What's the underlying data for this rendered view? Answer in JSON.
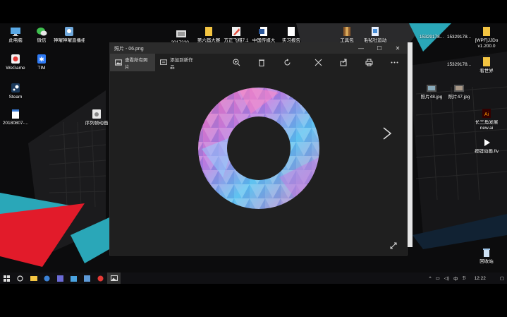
{
  "desktop": {
    "left_icons": [
      {
        "label": "此电脑",
        "icon": "computer-icon"
      },
      {
        "label": "微信",
        "icon": "wechat-icon"
      },
      {
        "label": "神曜神曜直播组",
        "icon": "app-icon"
      },
      {
        "label": "WeGame",
        "icon": "wegame-icon"
      },
      {
        "label": "TIM",
        "icon": "tim-icon"
      },
      {
        "label": "Steam",
        "icon": "steam-icon"
      },
      {
        "label": "20180807-...",
        "icon": "document-icon"
      },
      {
        "label": "序列帧动画",
        "icon": "folder-icon"
      }
    ],
    "top_icons": [
      {
        "label": "2017220..",
        "icon": "image-file-icon"
      },
      {
        "label": "第六届大赛",
        "icon": "folder-icon"
      },
      {
        "label": "方正飞翔7.1",
        "icon": "app-icon"
      },
      {
        "label": "中国传媒大",
        "icon": "word-file-icon"
      },
      {
        "label": "实习报告",
        "icon": "document-icon"
      },
      {
        "label": "工具包",
        "icon": "archive-icon"
      },
      {
        "label": "毛毡社运动",
        "icon": "folder-icon"
      }
    ],
    "right_icons": [
      {
        "label": "15329178...",
        "icon": "image-file-icon"
      },
      {
        "label": "15329178...",
        "icon": "image-file-icon"
      },
      {
        "label": "[WPF]JJDo v1.200.0",
        "icon": "folder-icon"
      },
      {
        "label": "15329178...",
        "icon": "image-file-icon"
      },
      {
        "label": "看世界",
        "icon": "folder-icon"
      },
      {
        "label": "照片48.jpg",
        "icon": "image-file-icon"
      },
      {
        "label": "照片47.jpg",
        "icon": "image-file-icon"
      },
      {
        "label": "长三角发展 new.ai",
        "icon": "illustrator-file-icon"
      },
      {
        "label": "按钮动画.flv",
        "icon": "video-file-icon"
      },
      {
        "label": "回收站",
        "icon": "recycle-bin-icon"
      }
    ]
  },
  "photo_window": {
    "title": "照片 - 06.png",
    "controls": {
      "minimize": "—",
      "maximize": "☐",
      "close": "✕"
    },
    "toolbar": {
      "view_all": "查看所有照片",
      "add_to_creation": "添加到新作品",
      "icons": [
        "zoom-in-icon",
        "delete-icon",
        "rotate-icon",
        "edit-icon",
        "share-icon",
        "print-icon",
        "more-icon"
      ]
    }
  },
  "taskbar": {
    "clock": "12:22",
    "ime": "中",
    "colors": {
      "bar": "#101013"
    }
  },
  "colors": {
    "window_bg": "#1f1f1f",
    "titlebar": "#2b2b2b",
    "accent_red": "#e21b2a",
    "accent_teal": "#2aa7b8"
  }
}
